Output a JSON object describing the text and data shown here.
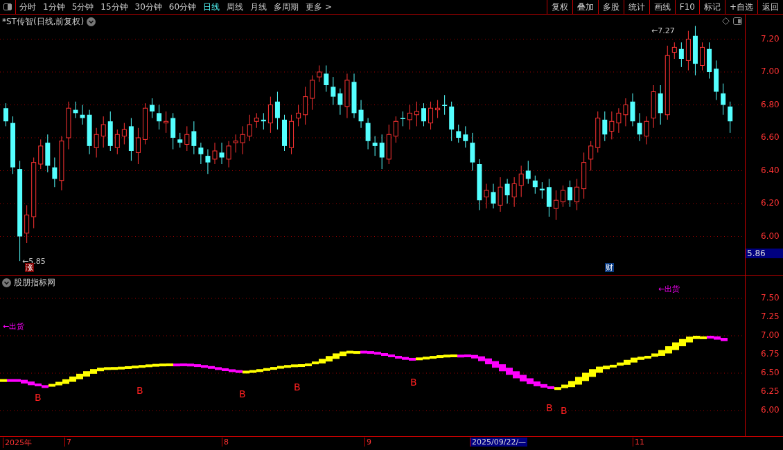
{
  "toolbar": {
    "periods": [
      {
        "label": "分时",
        "selected": false
      },
      {
        "label": "1分钟",
        "selected": false
      },
      {
        "label": "5分钟",
        "selected": false
      },
      {
        "label": "15分钟",
        "selected": false
      },
      {
        "label": "30分钟",
        "selected": false
      },
      {
        "label": "60分钟",
        "selected": false
      },
      {
        "label": "日线",
        "selected": true
      },
      {
        "label": "周线",
        "selected": false
      },
      {
        "label": "月线",
        "selected": false
      },
      {
        "label": "多周期",
        "selected": false
      },
      {
        "label": "更多 >",
        "selected": false
      }
    ],
    "actions": [
      "复权",
      "叠加",
      "多股",
      "统计",
      "画线",
      "F10",
      "标记",
      "+自选",
      "返回"
    ]
  },
  "main_chart": {
    "title": "*ST传智(日线,前复权)",
    "price_ticks": [
      "7.20",
      "7.00",
      "6.80",
      "6.60",
      "6.40",
      "6.20",
      "6.00"
    ],
    "current_price": "5.86",
    "low_marker": "←5.85",
    "high_marker": "←7.27",
    "badges": [
      {
        "kind": "rise",
        "text": "涨"
      },
      {
        "kind": "finance",
        "text": "财"
      }
    ]
  },
  "indicator": {
    "title": "股朋指标网",
    "ticks": [
      "7.50",
      "7.25",
      "7.00",
      "6.75",
      "6.50",
      "6.25",
      "6.00"
    ],
    "signals": [
      {
        "kind": "sell",
        "text": "←出货"
      },
      {
        "kind": "sell",
        "text": "←出货"
      },
      {
        "kind": "buy",
        "text": "B"
      },
      {
        "kind": "buy",
        "text": "B"
      },
      {
        "kind": "buy",
        "text": "B"
      },
      {
        "kind": "buy",
        "text": "B"
      },
      {
        "kind": "buy",
        "text": "B"
      },
      {
        "kind": "buy",
        "text": "B"
      },
      {
        "kind": "buy",
        "text": "B"
      }
    ]
  },
  "time_axis": [
    {
      "label": "2025年",
      "selected": false
    },
    {
      "label": "7",
      "selected": false
    },
    {
      "label": "8",
      "selected": false
    },
    {
      "label": "9",
      "selected": false
    },
    {
      "label": "2025/09/22/—",
      "selected": true
    },
    {
      "label": "11",
      "selected": false
    }
  ]
}
